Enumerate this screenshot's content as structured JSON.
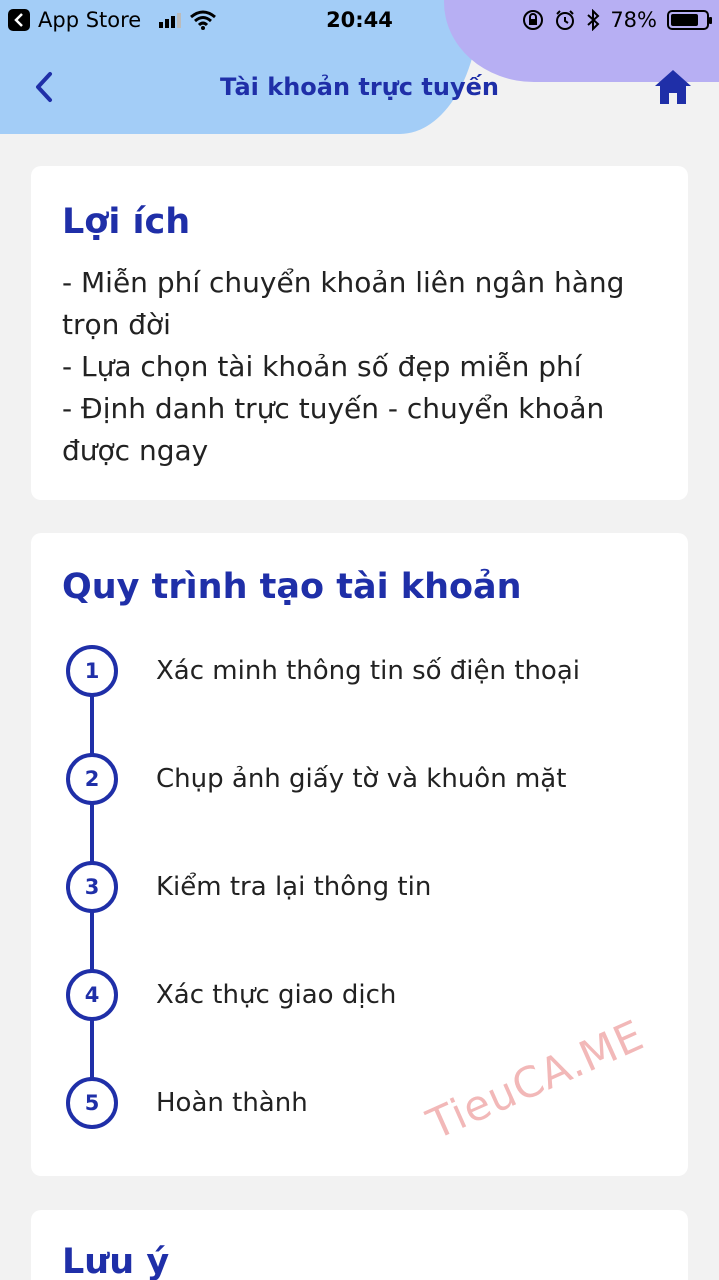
{
  "status_bar": {
    "back_app_label": "App Store",
    "time": "20:44",
    "battery_percent": "78%",
    "battery_level": 0.78
  },
  "nav": {
    "title": "Tài khoản trực tuyến"
  },
  "benefits": {
    "title": "Lợi ích",
    "items": [
      "- Miễn phí chuyển khoản liên ngân hàng trọn đời",
      "- Lựa chọn tài khoản số đẹp miễn phí",
      "- Định danh trực tuyến - chuyển khoản được ngay"
    ]
  },
  "process": {
    "title": "Quy trình tạo tài khoản",
    "steps": [
      {
        "number": "1",
        "label": "Xác minh thông tin số điện thoại"
      },
      {
        "number": "2",
        "label": "Chụp ảnh giấy tờ và khuôn mặt"
      },
      {
        "number": "3",
        "label": "Kiểm tra lại thông tin"
      },
      {
        "number": "4",
        "label": "Xác thực giao dịch"
      },
      {
        "number": "5",
        "label": "Hoàn thành"
      }
    ]
  },
  "notes": {
    "title": "Lưu ý"
  },
  "watermark": "TieuCA.ME",
  "colors": {
    "accent": "#1f2fa8",
    "header_blue": "#a3cdf7",
    "header_purple": "#b7aff3",
    "background": "#f2f2f2"
  }
}
